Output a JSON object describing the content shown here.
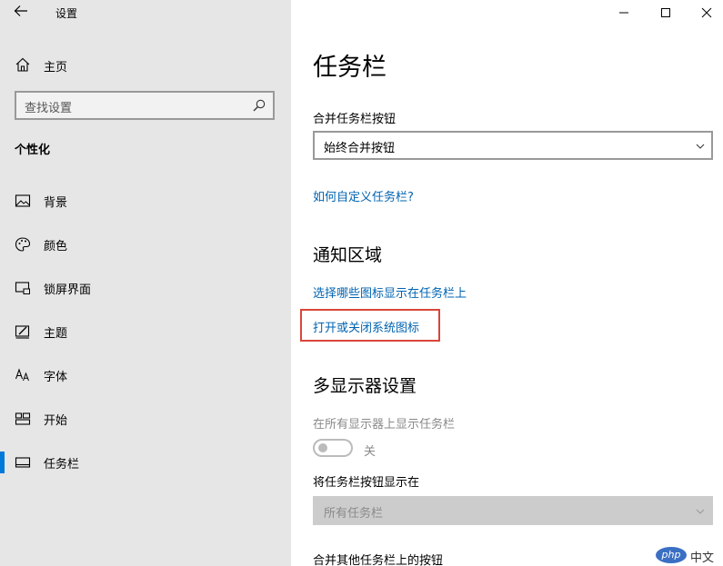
{
  "window": {
    "title": "设置",
    "back_icon": "arrow-left-icon",
    "controls": [
      "minimize-icon",
      "maximize-icon",
      "close-icon"
    ]
  },
  "sidebar": {
    "home_label": "主页",
    "search_placeholder": "查找设置",
    "section_title": "个性化",
    "items": [
      {
        "label": "背景",
        "icon": "image-icon"
      },
      {
        "label": "颜色",
        "icon": "palette-icon"
      },
      {
        "label": "锁屏界面",
        "icon": "lockscreen-icon"
      },
      {
        "label": "主题",
        "icon": "theme-icon"
      },
      {
        "label": "字体",
        "icon": "font-icon"
      },
      {
        "label": "开始",
        "icon": "start-icon"
      },
      {
        "label": "任务栏",
        "icon": "taskbar-icon",
        "selected": true
      }
    ],
    "accent_color": "#0078d7"
  },
  "main": {
    "title": "任务栏",
    "combine_label": "合并任务栏按钮",
    "combine_value": "始终合并按钮",
    "customize_link": "如何自定义任务栏?",
    "notification_heading": "通知区域",
    "select_icons_link": "选择哪些图标显示在任务栏上",
    "system_icons_link": "打开或关闭系统图标",
    "multi_display_heading": "多显示器设置",
    "show_all_label": "在所有显示器上显示任务栏",
    "toggle_state": "关",
    "show_buttons_label": "将任务栏按钮显示在",
    "show_buttons_value": "所有任务栏",
    "combine_other_label": "合并其他任务栏上的按钮"
  },
  "watermark": {
    "logo_text": "php",
    "site_text": "中文网"
  }
}
